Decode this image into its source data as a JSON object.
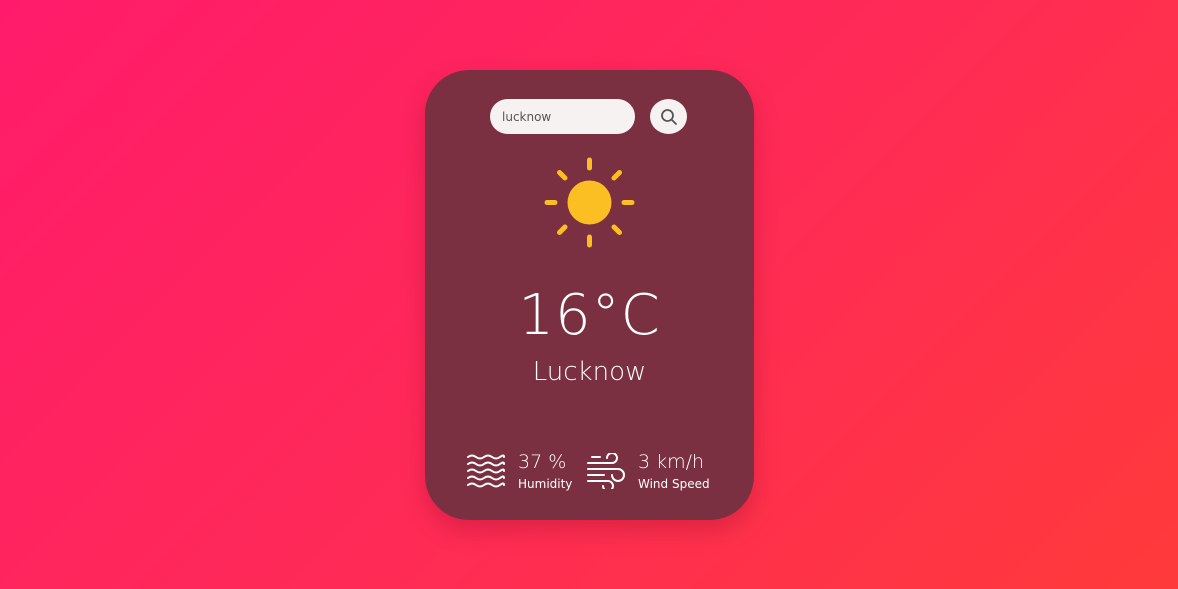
{
  "search": {
    "value": "lucknow",
    "button_icon": "search-icon"
  },
  "weather": {
    "icon": "sun-icon",
    "temperature": "16°C",
    "city": "Lucknow"
  },
  "details": {
    "humidity": {
      "icon": "humidity-waves-icon",
      "value": "37 %",
      "label": "Humidity"
    },
    "wind": {
      "icon": "wind-icon",
      "value": "3 km/h",
      "label": "Wind Speed"
    }
  },
  "colors": {
    "background_start": "#ff1b6b",
    "background_end": "#ff3a3a",
    "card": "#7a3040",
    "sun": "#fbbf24",
    "sun_core": "#f59e0b"
  }
}
